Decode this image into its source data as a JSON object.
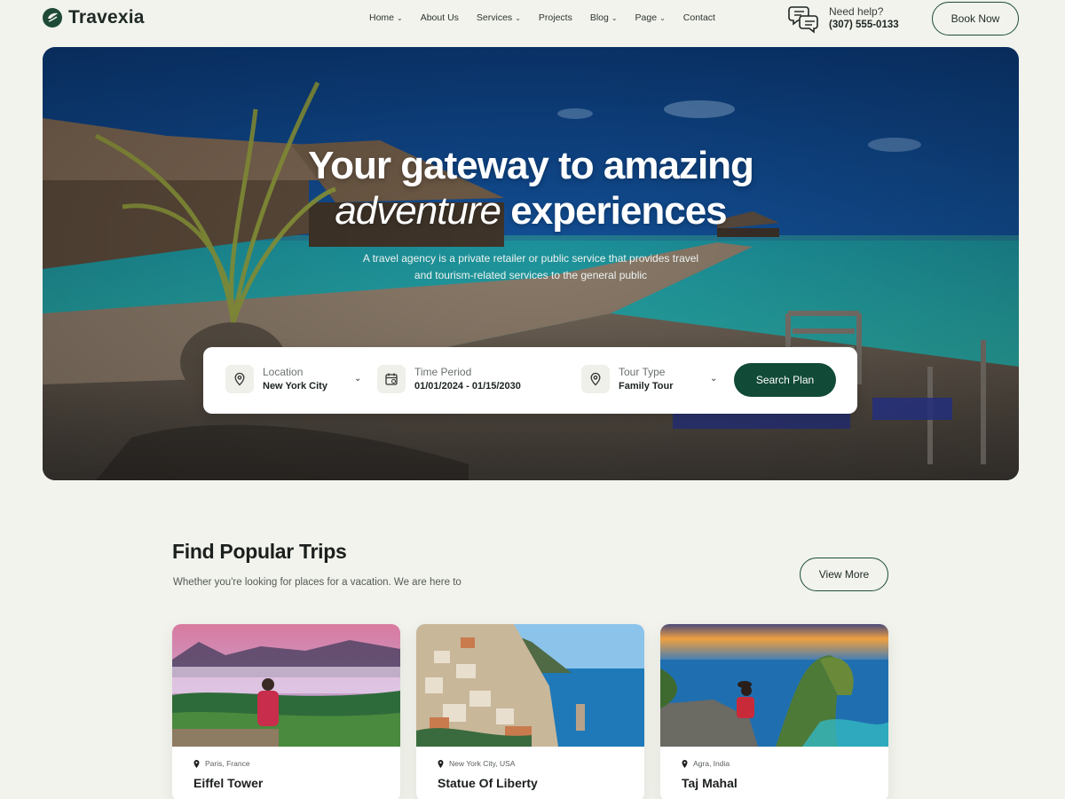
{
  "brand": {
    "name": "Travexia",
    "color": "#114a36"
  },
  "nav": {
    "items": [
      {
        "label": "Home",
        "dropdown": true
      },
      {
        "label": "About Us",
        "dropdown": false
      },
      {
        "label": "Services",
        "dropdown": true
      },
      {
        "label": "Projects",
        "dropdown": false
      },
      {
        "label": "Blog",
        "dropdown": true
      },
      {
        "label": "Page",
        "dropdown": true
      },
      {
        "label": "Contact",
        "dropdown": false
      }
    ]
  },
  "help": {
    "label": "Need help?",
    "phone": "(307) 555-0133"
  },
  "header": {
    "book_label": "Book Now"
  },
  "hero": {
    "title_line1": "Your gateway to amazing",
    "title_em": "adventure",
    "title_rest": " experiences",
    "subtitle": "A travel agency is a private retailer or public service that provides travel and tourism-related services to the general public"
  },
  "search": {
    "location": {
      "label": "Location",
      "value": "New York City",
      "icon": "map-pin-icon"
    },
    "time": {
      "label": "Time Period",
      "value": "01/01/2024 - 01/15/2030",
      "icon": "calendar-icon"
    },
    "tour": {
      "label": "Tour Type",
      "value": "Family Tour",
      "icon": "map-pin-icon"
    },
    "button": "Search Plan"
  },
  "popular": {
    "title": "Find Popular Trips",
    "subtitle": "Whether you're looking for places for a vacation. We are here to",
    "view_more": "View More",
    "cards": [
      {
        "location": "Paris, France",
        "name": "Eiffel Tower"
      },
      {
        "location": "New York City, USA",
        "name": "Statue Of Liberty"
      },
      {
        "location": "Agra, India",
        "name": "Taj Mahal"
      }
    ]
  }
}
